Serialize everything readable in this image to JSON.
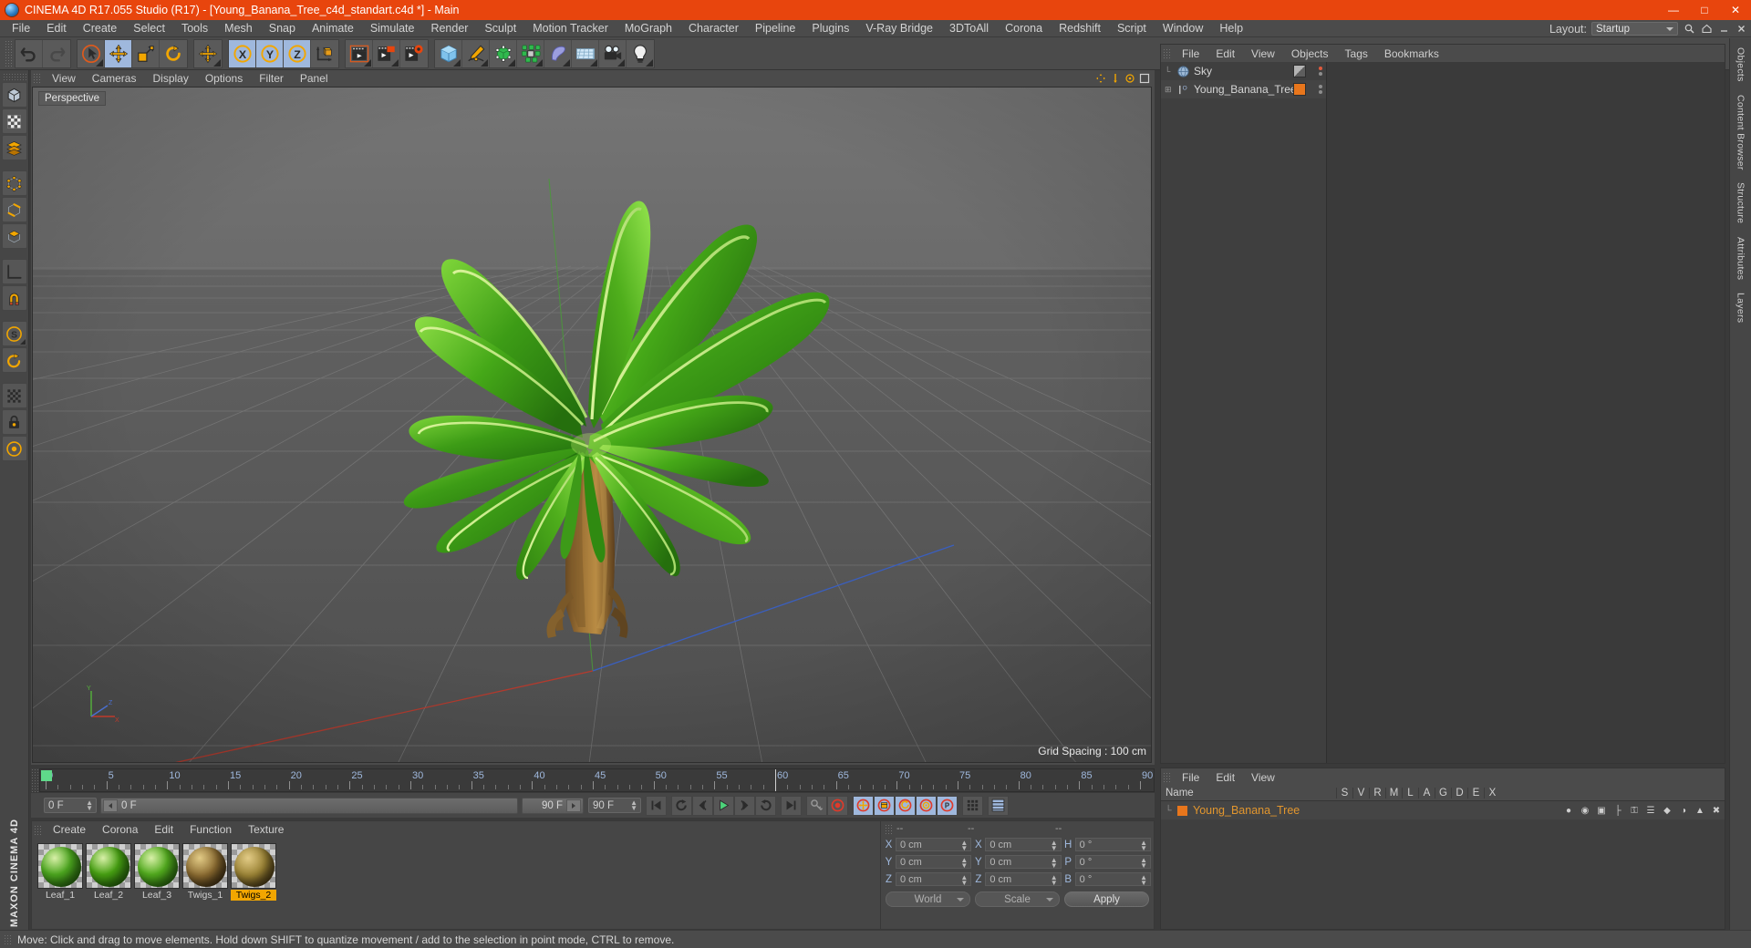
{
  "window": {
    "title": "CINEMA 4D R17.055 Studio (R17) - [Young_Banana_Tree_c4d_standart.c4d *] - Main",
    "minimize": "—",
    "maximize": "□",
    "close": "✕"
  },
  "menu": {
    "items": [
      "File",
      "Edit",
      "Create",
      "Select",
      "Tools",
      "Mesh",
      "Snap",
      "Animate",
      "Simulate",
      "Render",
      "Sculpt",
      "Motion Tracker",
      "MoGraph",
      "Character",
      "Pipeline",
      "Plugins",
      "V-Ray Bridge",
      "3DToAll",
      "Corona",
      "Redshift",
      "Script",
      "Window",
      "Help"
    ],
    "layout_label": "Layout:",
    "layout_value": "Startup"
  },
  "toolbar": {
    "groups": [
      {
        "buttons": [
          {
            "name": "undo-button",
            "icon": "undo",
            "selected": false,
            "corner": false
          },
          {
            "name": "redo-button",
            "icon": "redo",
            "selected": false,
            "corner": false
          }
        ]
      },
      {
        "buttons": [
          {
            "name": "live-selection-tool",
            "icon": "cursor-circle",
            "selected": false,
            "corner": true
          },
          {
            "name": "move-tool",
            "icon": "move",
            "selected": true,
            "corner": false
          },
          {
            "name": "scale-tool",
            "icon": "scale",
            "selected": false,
            "corner": false
          },
          {
            "name": "rotate-tool",
            "icon": "rotate",
            "selected": false,
            "corner": false
          }
        ]
      },
      {
        "buttons": [
          {
            "name": "move-axis-tool",
            "icon": "move",
            "selected": false,
            "corner": true
          }
        ]
      },
      {
        "buttons": [
          {
            "name": "x-axis-lock",
            "icon": "axis-x",
            "selected": true,
            "corner": false
          },
          {
            "name": "y-axis-lock",
            "icon": "axis-y",
            "selected": true,
            "corner": false
          },
          {
            "name": "z-axis-lock",
            "icon": "axis-z",
            "selected": true,
            "corner": false
          },
          {
            "name": "world-coordinate-toggle",
            "icon": "world-axis",
            "selected": false,
            "corner": false
          }
        ]
      },
      {
        "buttons": [
          {
            "name": "render-view-button",
            "icon": "render-view",
            "selected": false,
            "corner": true
          },
          {
            "name": "render-region-button",
            "icon": "render-region",
            "selected": false,
            "corner": true
          },
          {
            "name": "render-settings-button",
            "icon": "render-settings",
            "selected": false,
            "corner": false
          }
        ]
      },
      {
        "buttons": [
          {
            "name": "add-cube-button",
            "icon": "cube",
            "selected": false,
            "corner": true
          },
          {
            "name": "add-spline-button",
            "icon": "pen-spline",
            "selected": false,
            "corner": true
          },
          {
            "name": "add-nurbs-button",
            "icon": "nurbs",
            "selected": false,
            "corner": true
          },
          {
            "name": "add-array-button",
            "icon": "mograph-array",
            "selected": false,
            "corner": true
          },
          {
            "name": "add-bend-deformer-button",
            "icon": "bend",
            "selected": false,
            "corner": true
          },
          {
            "name": "add-floor-button",
            "icon": "floor",
            "selected": false,
            "corner": true
          },
          {
            "name": "add-camera-button",
            "icon": "camera",
            "selected": false,
            "corner": true
          },
          {
            "name": "add-light-button",
            "icon": "light-bulb",
            "selected": false,
            "corner": true
          }
        ]
      }
    ]
  },
  "left_palette": {
    "buttons": [
      {
        "name": "model-mode-tool",
        "icon": "cube-model",
        "corner": false
      },
      {
        "name": "texture-mode-tool",
        "icon": "checker-texture",
        "corner": false
      },
      {
        "name": "layer-mode-tool",
        "icon": "stack-layers",
        "corner": false
      },
      {
        "name": "point-mode-tool",
        "icon": "points",
        "corner": false
      },
      {
        "name": "edge-mode-tool",
        "icon": "edges",
        "corner": false
      },
      {
        "name": "polygon-mode-tool",
        "icon": "polygons",
        "corner": false
      },
      {
        "name": "workplane-tool",
        "icon": "workplane",
        "corner": false
      },
      {
        "name": "magnet-tool",
        "icon": "magnet",
        "corner": false
      },
      {
        "name": "snap-tool",
        "icon": "snap-s",
        "corner": true
      },
      {
        "name": "axis-modify-tool",
        "icon": "axis-modify",
        "corner": false
      },
      {
        "name": "viewport-solo-tool",
        "icon": "grid-solo",
        "corner": false
      },
      {
        "name": "lock-axis-tool",
        "icon": "lock-axis",
        "corner": false
      },
      {
        "name": "enable-axis-tool",
        "icon": "enable-axis",
        "corner": false
      }
    ]
  },
  "viewport": {
    "menu": [
      "View",
      "Cameras",
      "Display",
      "Options",
      "Filter",
      "Panel"
    ],
    "label": "Perspective",
    "grid_spacing": "Grid Spacing : 100 cm",
    "axis_labels": [
      "Y",
      "Z",
      "X"
    ],
    "nav_icons": [
      "pan-icon",
      "dolly-icon",
      "orbit-icon",
      "maximize-viewport-icon"
    ]
  },
  "timeline": {
    "ticks": [
      0,
      5,
      10,
      15,
      20,
      25,
      30,
      35,
      40,
      45,
      50,
      55,
      60,
      65,
      70,
      75,
      80,
      85,
      90
    ],
    "current_frame": "0 F",
    "end_frame": "90 F",
    "preview_range_end": "90 F",
    "playhead_frame": 0,
    "transport": [
      {
        "name": "go-to-start-button",
        "icon": "skip-start"
      },
      {
        "name": "previous-key-button",
        "icon": "prev-key"
      },
      {
        "name": "step-back-button",
        "icon": "step-back"
      },
      {
        "name": "play-button",
        "icon": "play"
      },
      {
        "name": "step-forward-button",
        "icon": "step-forward"
      },
      {
        "name": "next-key-button",
        "icon": "next-key"
      },
      {
        "name": "go-to-end-button",
        "icon": "skip-end"
      },
      {
        "name": "autokey-toggle",
        "icon": "key"
      },
      {
        "name": "record-button",
        "icon": "record"
      },
      {
        "name": "record-position-button",
        "icon": "record-pos"
      },
      {
        "name": "record-rotation-button",
        "icon": "record-rot"
      },
      {
        "name": "record-scale-button",
        "icon": "record-scale"
      },
      {
        "name": "record-param-button",
        "icon": "record-param"
      },
      {
        "name": "record-pla-button",
        "icon": "record-pla"
      },
      {
        "name": "keyframe-selection-button",
        "icon": "key-select"
      },
      {
        "name": "timeline-view-button",
        "icon": "timeline-view"
      }
    ]
  },
  "material_manager": {
    "menu": [
      "Create",
      "Corona",
      "Edit",
      "Function",
      "Texture"
    ],
    "materials": [
      {
        "name": "Leaf_1",
        "color": "#4ca61f",
        "selected": false,
        "kind": "leaf"
      },
      {
        "name": "Leaf_2",
        "color": "#47a012",
        "selected": false,
        "kind": "leaf"
      },
      {
        "name": "Leaf_3",
        "color": "#52ab1e",
        "selected": false,
        "kind": "leaf"
      },
      {
        "name": "Twigs_1",
        "color": "#8a6a30",
        "selected": false,
        "kind": "bark"
      },
      {
        "name": "Twigs_2",
        "color": "#9a8234",
        "selected": true,
        "kind": "bark"
      }
    ]
  },
  "coordinates": {
    "header": [
      "--",
      "--",
      "--"
    ],
    "rows": [
      {
        "pos_label": "X",
        "pos_value": "0 cm",
        "size_label": "X",
        "size_value": "0 cm",
        "rot_label": "H",
        "rot_value": "0 °"
      },
      {
        "pos_label": "Y",
        "pos_value": "0 cm",
        "size_label": "Y",
        "size_value": "0 cm",
        "rot_label": "P",
        "rot_value": "0 °"
      },
      {
        "pos_label": "Z",
        "pos_value": "0 cm",
        "size_label": "Z",
        "size_value": "0 cm",
        "rot_label": "B",
        "rot_value": "0 °"
      }
    ],
    "system": "World",
    "mode": "Scale",
    "apply": "Apply"
  },
  "object_manager": {
    "menu": [
      "File",
      "Edit",
      "View",
      "Objects",
      "Tags",
      "Bookmarks"
    ],
    "objects": [
      {
        "name": "Sky",
        "icon": "sky-sphere-icon",
        "tag": "gradient-tag",
        "dot_color": "#e05a3d",
        "expandable": false
      },
      {
        "name": "Young_Banana_Tree",
        "icon": "null-object-icon",
        "tag": "orange-tag",
        "dot_color": "#8d8d8d",
        "expandable": true
      }
    ]
  },
  "layer_manager": {
    "menu": [
      "File",
      "Edit",
      "View"
    ],
    "columns": [
      "Name",
      "S",
      "V",
      "R",
      "M",
      "L",
      "A",
      "G",
      "D",
      "E",
      "X"
    ],
    "rows": [
      {
        "name": "Young_Banana_Tree",
        "color": "#e8761c"
      }
    ]
  },
  "dock_right": {
    "tabs": [
      "Objects",
      "Content Browser",
      "Structure",
      "Attributes",
      "Layers"
    ]
  },
  "brand": {
    "text": "MAXON CINEMA 4D"
  },
  "statusbar": {
    "text": "Move: Click and drag to move elements. Hold down SHIFT to quantize movement / add to the selection in point mode, CTRL to remove."
  }
}
